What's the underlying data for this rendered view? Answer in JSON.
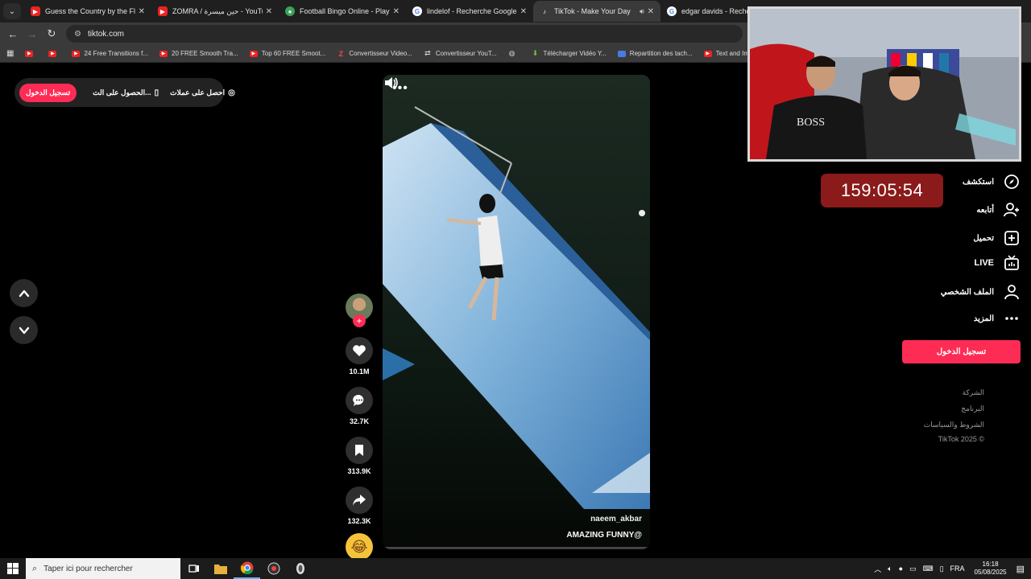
{
  "browser": {
    "tabs": [
      {
        "title": "Guess the Country by the Fl",
        "favicon": "youtube-icon"
      },
      {
        "title": "ZOMRA / حين ميسرة - YouTube",
        "favicon": "youtube-icon"
      },
      {
        "title": "Football Bingo Online - Play N",
        "favicon": "football-icon"
      },
      {
        "title": "lindelof - Recherche Google",
        "favicon": "google-icon"
      },
      {
        "title": "TikTok - Make Your Day",
        "favicon": "tiktok-icon",
        "active": true
      },
      {
        "title": "edgar davids - Recherche",
        "favicon": "google-icon"
      }
    ],
    "url": "tiktok.com",
    "bookmarks": [
      {
        "label": "",
        "icon": "youtube-icon"
      },
      {
        "label": "",
        "icon": "youtube-icon"
      },
      {
        "label": "24 Free Transitions f...",
        "icon": "youtube-icon"
      },
      {
        "label": "20 FREE Smooth Tra...",
        "icon": "youtube-icon"
      },
      {
        "label": "Top 60 FREE Smoot...",
        "icon": "youtube-icon"
      },
      {
        "label": "Convertisseur Video...",
        "icon": "z-icon"
      },
      {
        "label": "Convertisseur YouT...",
        "icon": "convert-icon"
      },
      {
        "label": "",
        "icon": "globe-icon"
      },
      {
        "label": "Télécharger Vidéo Y...",
        "icon": "download-icon"
      },
      {
        "label": "Repartition des tach...",
        "icon": "doc-icon"
      },
      {
        "label": "Text and Image ani...",
        "icon": "youtube-icon"
      }
    ]
  },
  "tiktok": {
    "topbar": {
      "login": "تسجيل الدخول",
      "get_app": "الحصول على الت...",
      "get_coins": "احصل على عملات"
    },
    "video": {
      "username": "naeem_akbar",
      "caption": "AMAZING FUNNY@",
      "progress": 0.0
    },
    "actions": {
      "likes": "10.1M",
      "comments": "32.7K",
      "saves": "313.9K",
      "shares": "132.3K"
    },
    "nav": [
      {
        "label": "استكشف",
        "icon": "compass-icon"
      },
      {
        "label": "أتابعه",
        "icon": "user-follow-icon"
      },
      {
        "label": "تحميل",
        "icon": "upload-icon"
      },
      {
        "label": "LIVE",
        "icon": "live-icon"
      },
      {
        "label": "الملف الشخصي",
        "icon": "profile-icon"
      },
      {
        "label": "المزيد",
        "icon": "more-icon"
      }
    ],
    "login_button": "تسجيل الدخول",
    "footer": [
      "الشركة",
      "البرنامج",
      "الشروط والسياسات",
      "TikTok 2025 ©"
    ]
  },
  "overlay": {
    "timer": "159:05:54",
    "webcam_text": "BOSS"
  },
  "taskbar": {
    "search_placeholder": "Taper ici pour rechercher",
    "lang": "FRA",
    "time": "16:18",
    "date": "05/08/2025"
  }
}
